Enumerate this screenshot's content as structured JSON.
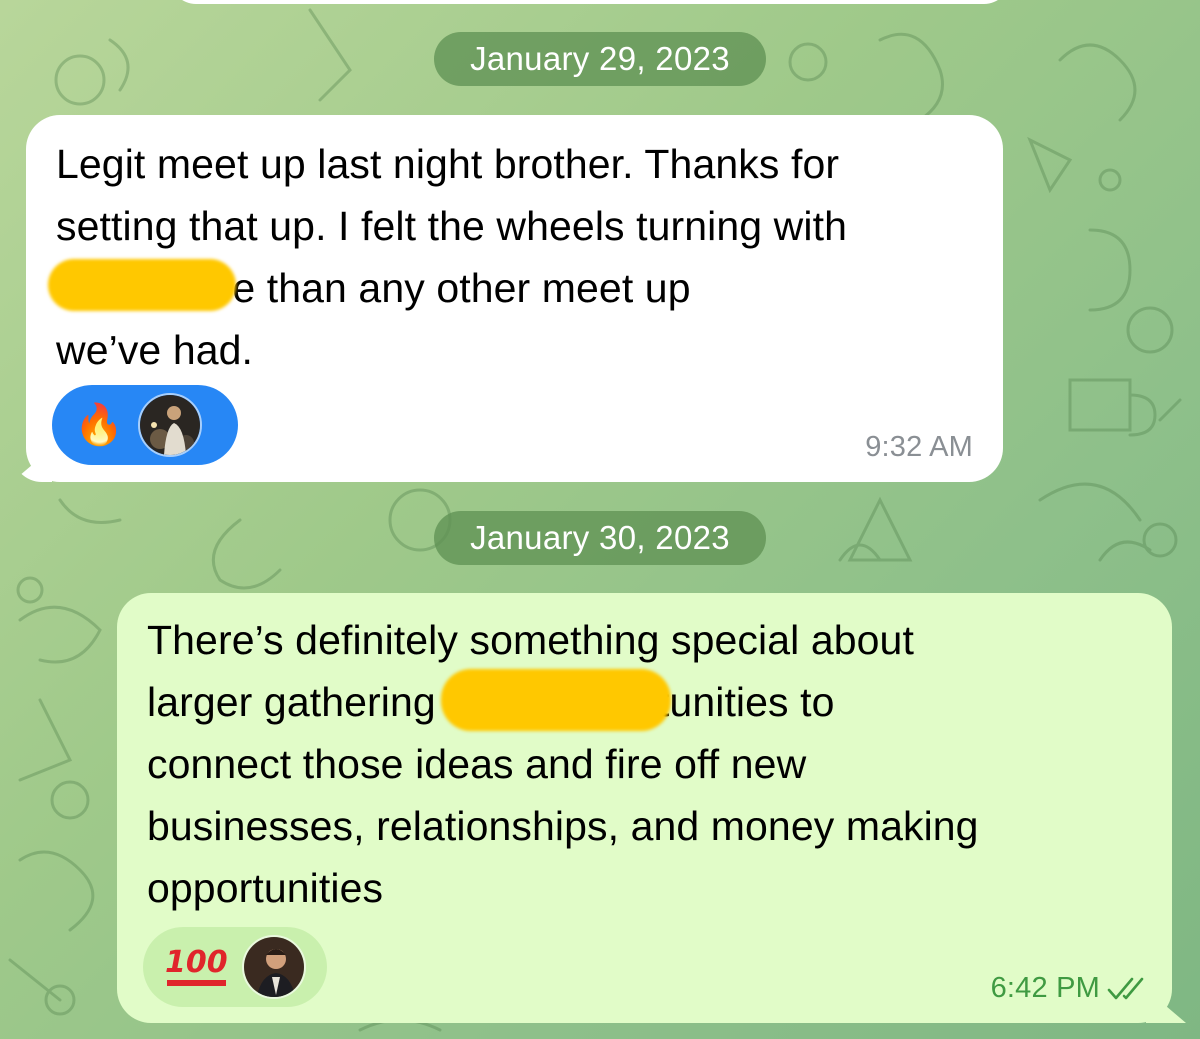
{
  "colors": {
    "incoming_bubble": "#ffffff",
    "outgoing_bubble": "#e1fcc8",
    "date_pill": "#609254",
    "reaction_active": "#2787f5",
    "outgoing_time": "#3f9a42",
    "redaction": "#ffc800"
  },
  "dates": {
    "first": "January 29, 2023",
    "second": "January 30, 2023"
  },
  "messages": {
    "incoming": {
      "text": "Legit meet up last night brother. Thanks for\nsetting that up. I felt the wheels turning with\n                  there more than any other meet up\nwe’ve had.",
      "time": "9:32 AM",
      "reaction": {
        "emoji": "🔥",
        "icon": "fire-emoji",
        "selected": true
      }
    },
    "outgoing": {
      "text": "There’s definitely something special about\nlarger gathering                          More opportunities to\nconnect those ideas and fire off new\nbusinesses, relationships, and money making\nopportunities",
      "time": "6:42 PM",
      "status": "read",
      "reaction": {
        "emoji": "100",
        "icon": "hundred-points-emoji",
        "selected": false
      }
    }
  }
}
